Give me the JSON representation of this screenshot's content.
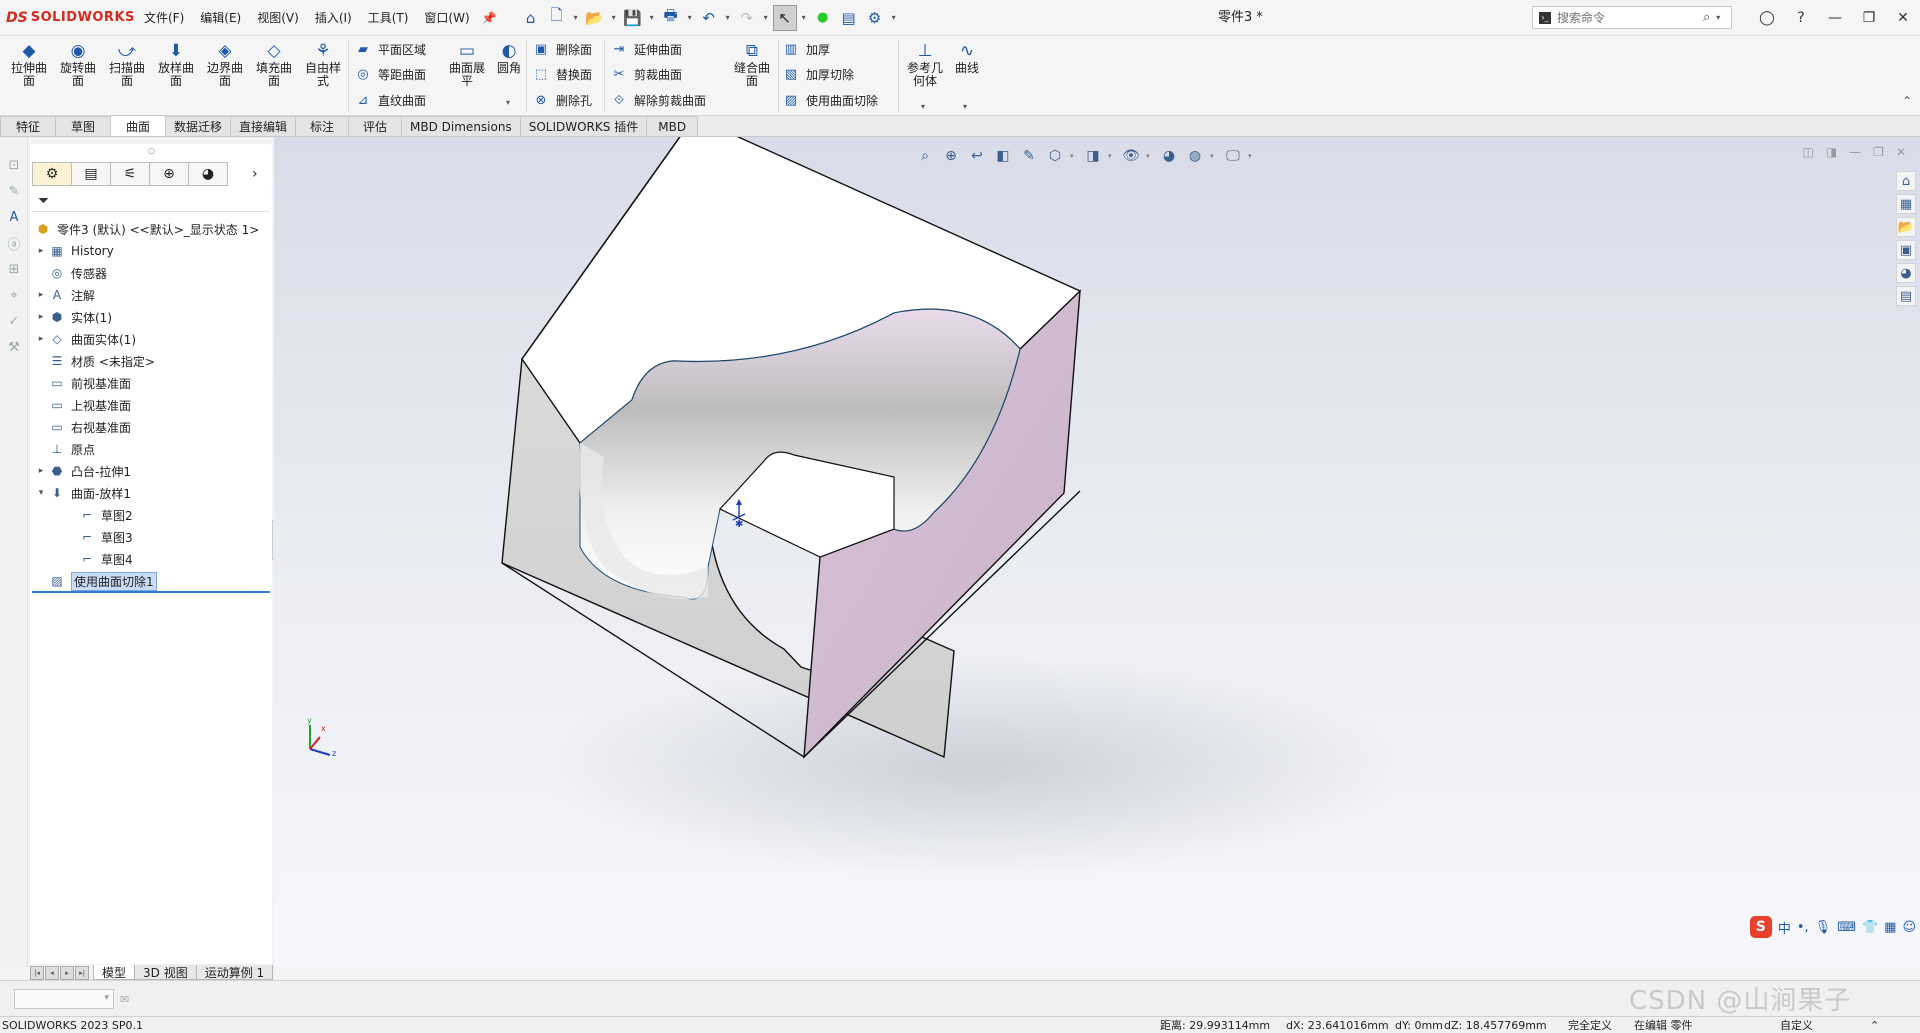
{
  "app": {
    "logo_symbol": "DS",
    "logo_text": "SOLIDWORKS",
    "document_title": "零件3 *"
  },
  "menu": [
    "文件(F)",
    "编辑(E)",
    "视图(V)",
    "插入(I)",
    "工具(T)",
    "窗口(W)"
  ],
  "search": {
    "placeholder": "搜索命令"
  },
  "ribbon": {
    "big_buttons": [
      {
        "label": "拉伸曲面",
        "icon": "extrude-surface-icon"
      },
      {
        "label": "旋转曲面",
        "icon": "revolve-surface-icon"
      },
      {
        "label": "扫描曲面",
        "icon": "sweep-surface-icon"
      },
      {
        "label": "放样曲面",
        "icon": "loft-surface-icon"
      },
      {
        "label": "边界曲面",
        "icon": "boundary-surface-icon"
      },
      {
        "label": "填充曲面",
        "icon": "fill-surface-icon"
      },
      {
        "label": "自由样式",
        "icon": "freeform-icon"
      }
    ],
    "group1": [
      "平面区域",
      "等距曲面",
      "直纹曲面"
    ],
    "extend_flat": "曲面展平",
    "fillet": "圆角",
    "group2": [
      "删除面",
      "替换面",
      "删除孔"
    ],
    "group3": [
      "延伸曲面",
      "剪裁曲面",
      "解除剪裁曲面"
    ],
    "knit": "缝合曲面",
    "group4": [
      "加厚",
      "加厚切除",
      "使用曲面切除"
    ],
    "ref_geometry": "参考几何体",
    "curves": "曲线"
  },
  "tabs": [
    "特征",
    "草图",
    "曲面",
    "数据迁移",
    "直接编辑",
    "标注",
    "评估",
    "MBD Dimensions",
    "SOLIDWORKS 插件",
    "MBD"
  ],
  "active_tab": "曲面",
  "tree": {
    "root": "零件3 (默认) <<默认>_显示状态 1>",
    "items": [
      {
        "label": "History",
        "expander": "▸",
        "icon": "history-folder-icon"
      },
      {
        "label": "传感器",
        "expander": "",
        "icon": "sensor-icon"
      },
      {
        "label": "注解",
        "expander": "▸",
        "icon": "annotation-icon"
      },
      {
        "label": "实体(1)",
        "expander": "▸",
        "icon": "solid-body-icon"
      },
      {
        "label": "曲面实体(1)",
        "expander": "▸",
        "icon": "surface-body-icon"
      },
      {
        "label": "材质 <未指定>",
        "expander": "",
        "icon": "material-icon"
      },
      {
        "label": "前视基准面",
        "expander": "",
        "icon": "plane-icon"
      },
      {
        "label": "上视基准面",
        "expander": "",
        "icon": "plane-icon"
      },
      {
        "label": "右视基准面",
        "expander": "",
        "icon": "plane-icon"
      },
      {
        "label": "原点",
        "expander": "",
        "icon": "origin-icon"
      },
      {
        "label": "凸台-拉伸1",
        "expander": "▸",
        "icon": "boss-extrude-icon"
      },
      {
        "label": "曲面-放样1",
        "expander": "▾",
        "icon": "surface-loft-icon"
      }
    ],
    "subitems": [
      "草图2",
      "草图3",
      "草图4"
    ],
    "selected": "使用曲面切除1"
  },
  "bottom_tabs": [
    "模型",
    "3D 视图",
    "运动算例 1"
  ],
  "active_bottom_tab": "模型",
  "triad": {
    "x": "x",
    "y": "y",
    "z": "z"
  },
  "ime": {
    "lang": "中",
    "punct": "•,"
  },
  "status": {
    "version": "SOLIDWORKS 2023 SP0.1",
    "distance": "距离: 29.993114mm",
    "dx": "dX: 23.641016mm",
    "dy": "dY: 0mm",
    "dz": "dZ: 18.457769mm",
    "state": "完全定义",
    "editing": "在编辑 零件",
    "custom": "自定义"
  },
  "watermark": "CSDN @山涧果子",
  "colors": {
    "brand": "#d52b1e",
    "face_top": "#ffffff",
    "face_front": "#d2d2d2",
    "face_right": "#ccb7cc",
    "accent": "#2a7fd4"
  }
}
